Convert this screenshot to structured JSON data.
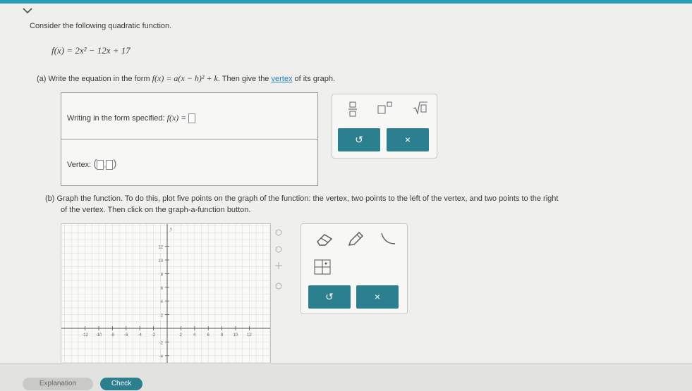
{
  "question": {
    "intro": "Consider the following quadratic function.",
    "function": "f(x) = 2x² − 12x + 17",
    "part_a": {
      "prefix": "(a) Write the equation in the form",
      "form": "f(x) = a(x − h)² + k",
      "suffix1": ". Then give the",
      "vertex_link": "vertex",
      "suffix2": "of its graph."
    },
    "part_b_line1": "(b) Graph the function. To do this, plot five points on the graph of the function: the vertex, two points to the left of the vertex, and two points to the right",
    "part_b_line2": "of the vertex. Then click on the graph-a-function button."
  },
  "answer": {
    "form_label": "Writing in the form specified:",
    "form_math": "f(x) =",
    "vertex_label": "Vertex:"
  },
  "toolbar1": {
    "fraction_icon": "fraction-icon",
    "superscript_icon": "superscript-icon",
    "sqrt_icon": "sqrt-icon",
    "undo_symbol": "↺",
    "close_symbol": "×"
  },
  "graph": {
    "y_ticks": [
      "12",
      "10",
      "8",
      "6",
      "4",
      "2",
      "-2",
      "-4",
      "-6"
    ],
    "x_ticks": [
      "-12",
      "-10",
      "-8",
      "-6",
      "-4",
      "-2",
      "2",
      "4",
      "6",
      "8",
      "10",
      "12"
    ],
    "y_axis_label": "y"
  },
  "toolbar2": {
    "undo_symbol": "↺",
    "close_symbol": "×"
  },
  "bottom": {
    "explanation": "Explanation",
    "check": "Check"
  },
  "colors": {
    "accent": "#2c7f8e",
    "top_bar": "#2a9fb8",
    "link": "#2a7fb8"
  }
}
